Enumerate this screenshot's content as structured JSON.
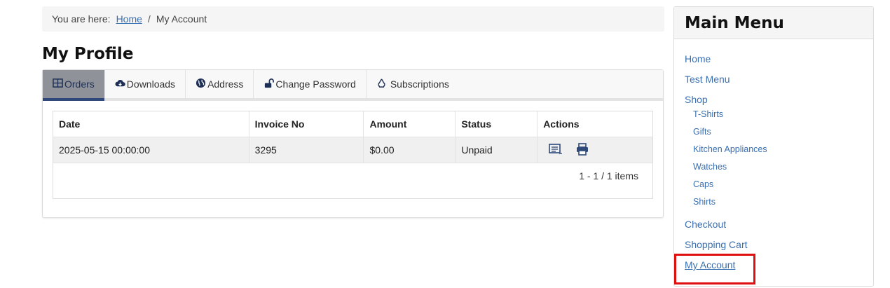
{
  "breadcrumb": {
    "prefix": "You are here:",
    "home": "Home",
    "separator": "/",
    "current": "My Account"
  },
  "page_title": "My Profile",
  "tabs": [
    {
      "label": "Orders",
      "icon": "table-icon"
    },
    {
      "label": "Downloads",
      "icon": "cloud-download-icon"
    },
    {
      "label": "Address",
      "icon": "globe-icon"
    },
    {
      "label": "Change Password",
      "icon": "unlock-icon"
    },
    {
      "label": "Subscriptions",
      "icon": "recycle-icon"
    }
  ],
  "orders_table": {
    "headers": [
      "Date",
      "Invoice No",
      "Amount",
      "Status",
      "Actions"
    ],
    "rows": [
      {
        "date": "2025-05-15 00:00:00",
        "invoice": "3295",
        "amount": "$0.00",
        "status": "Unpaid",
        "actions": [
          "view-details-icon",
          "print-icon"
        ]
      }
    ],
    "pager": "1 - 1 / 1 items"
  },
  "sidebar": {
    "title": "Main Menu",
    "items": [
      "Home",
      "Test Menu",
      "Shop"
    ],
    "shop_children": [
      "T-Shirts",
      "Gifts",
      "Kitchen Appliances",
      "Watches",
      "Caps",
      "Shirts"
    ],
    "after_items": [
      "Checkout",
      "Shopping Cart",
      "My Account"
    ]
  },
  "colors": {
    "link": "#3a6fb0",
    "active_tab_bg": "#8f9399",
    "active_tab_bar": "#2f4a7a",
    "highlight": "#e01010"
  }
}
